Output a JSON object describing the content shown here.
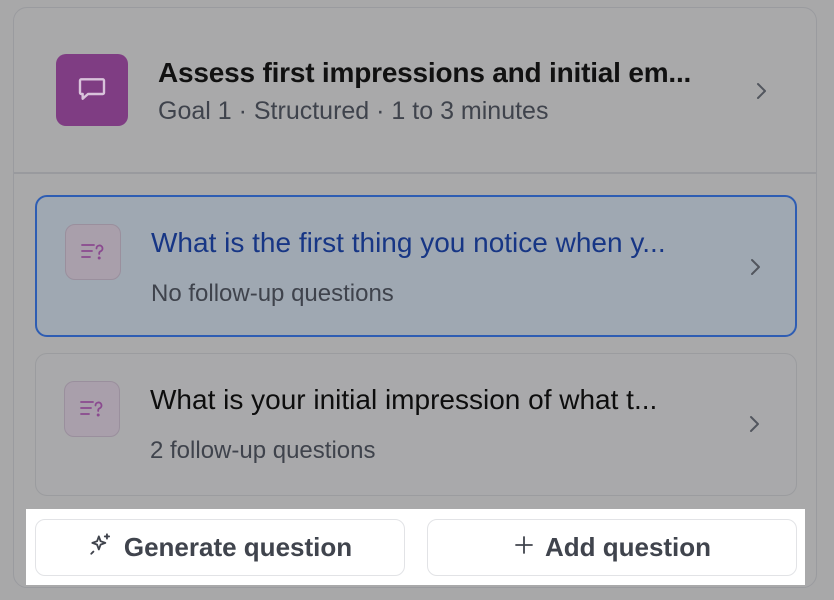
{
  "goal": {
    "title": "Assess first impressions and initial em...",
    "meta": "Goal 1 · Structured · 1 to 3 minutes",
    "badge_icon": "chat-bubble-icon",
    "badge_color": "#7f3d83"
  },
  "questions": [
    {
      "title": "What is the first thing you notice when y...",
      "subtitle": "No follow-up questions",
      "selected": true,
      "icon": "question-list-icon"
    },
    {
      "title": "What is your initial impression of what t...",
      "subtitle": "2 follow-up questions",
      "selected": false,
      "icon": "question-list-icon"
    }
  ],
  "actions": {
    "generate_label": "Generate question",
    "generate_icon": "sparkle-icon",
    "add_label": "Add question",
    "add_icon": "plus-icon"
  },
  "colors": {
    "selected_border": "#2e5db3",
    "selected_title": "#173685"
  }
}
